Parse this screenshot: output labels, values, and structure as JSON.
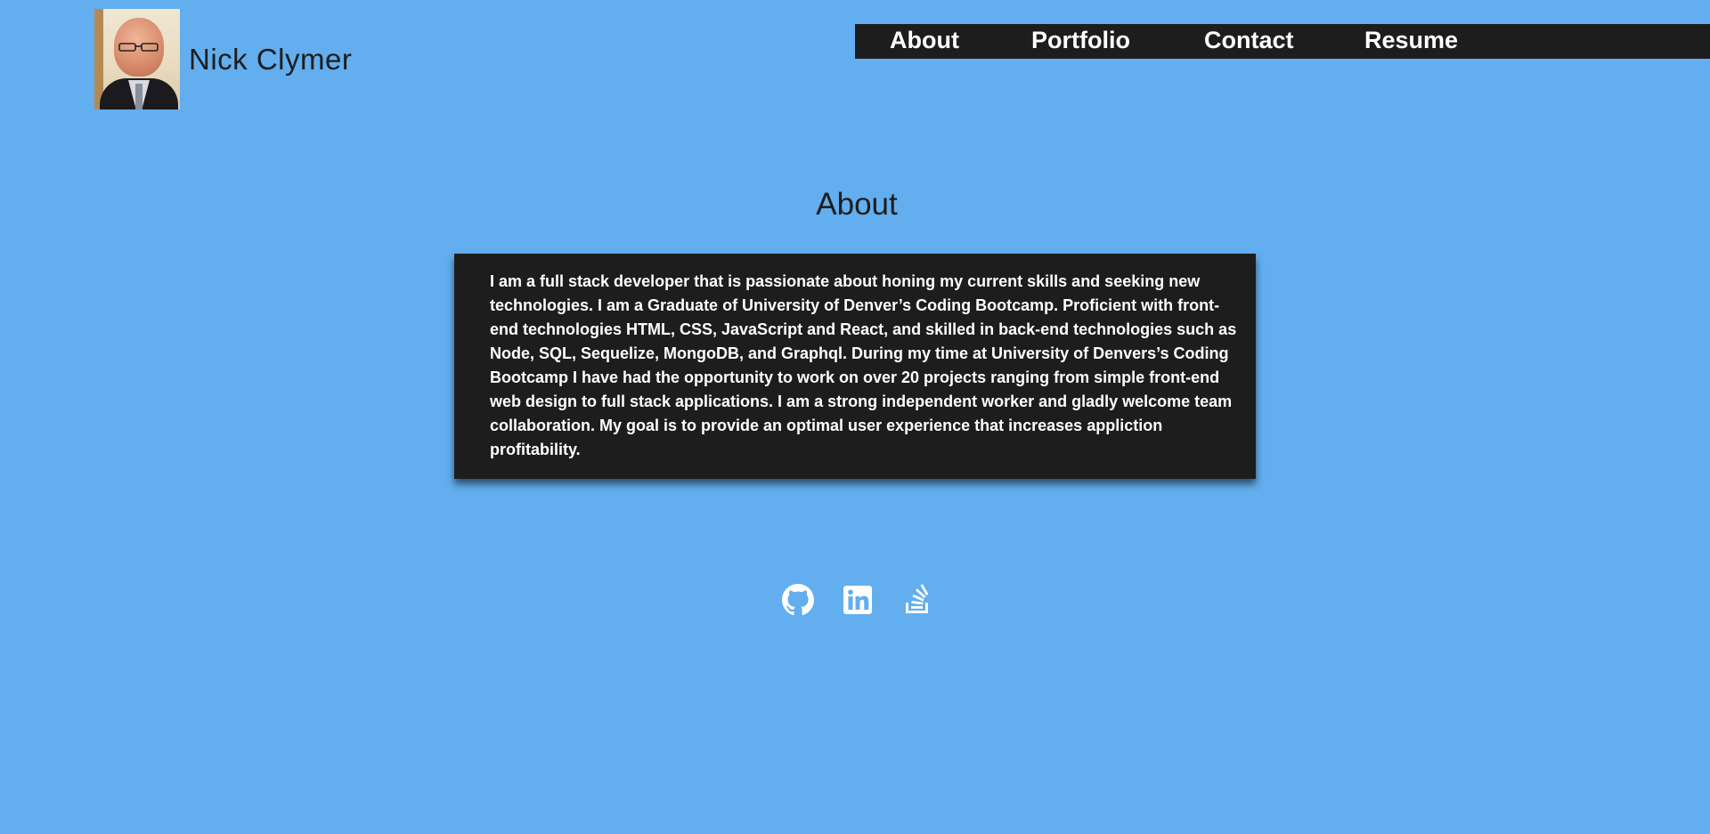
{
  "header": {
    "name": "Nick Clymer"
  },
  "nav": {
    "items": [
      {
        "label": "About"
      },
      {
        "label": "Portfolio"
      },
      {
        "label": "Contact"
      },
      {
        "label": "Resume"
      }
    ]
  },
  "about": {
    "title": "About",
    "body": "I am a full stack developer that is passionate about honing my current skills and seeking new technologies. I am a Graduate of University of Denver’s Coding Bootcamp. Proficient with front-end technologies HTML, CSS, JavaScript and React, and skilled in back-end technologies such as Node, SQL, Sequelize, MongoDB, and Graphql. During my time at University of Denvers’s Coding Bootcamp I have had the opportunity to work on over 20 projects ranging from simple front-end web design to full stack applications. I am a strong independent worker and gladly welcome team collaboration. My goal is to provide an optimal user experience that increases appliction profitability."
  },
  "social": {
    "icons": [
      "github-icon",
      "linkedin-icon",
      "stackoverflow-icon"
    ]
  },
  "colors": {
    "background": "#62aeee",
    "dark": "#1e1d1e",
    "text_light": "#ffffff"
  }
}
